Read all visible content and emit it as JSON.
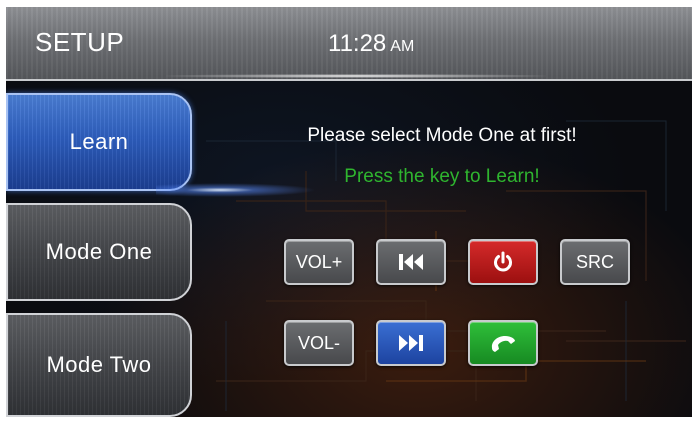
{
  "header": {
    "title": "SETUP",
    "time": "11:28",
    "ampm": "AM"
  },
  "menu": {
    "items": [
      {
        "label": "Learn",
        "active": true
      },
      {
        "label": "Mode One",
        "active": false
      },
      {
        "label": "Mode Two",
        "active": false
      }
    ]
  },
  "messages": {
    "instruction": "Please select Mode One at first!",
    "prompt": "Press the key to Learn!"
  },
  "keys": {
    "vol_up": {
      "label": "VOL+",
      "color": "#48494c"
    },
    "prev": {
      "icon": "skip-previous-icon",
      "color": "#48494c"
    },
    "power": {
      "icon": "power-icon",
      "color": "#b31515"
    },
    "src": {
      "label": "SRC",
      "color": "#48494c"
    },
    "vol_down": {
      "label": "VOL-",
      "color": "#48494c"
    },
    "next": {
      "icon": "skip-next-icon",
      "color": "#2450b0"
    },
    "call": {
      "icon": "phone-icon",
      "color": "#1f9e2a"
    }
  },
  "colors": {
    "accent_blue": "#2e5fc0",
    "prompt_green": "#2fb52f"
  }
}
